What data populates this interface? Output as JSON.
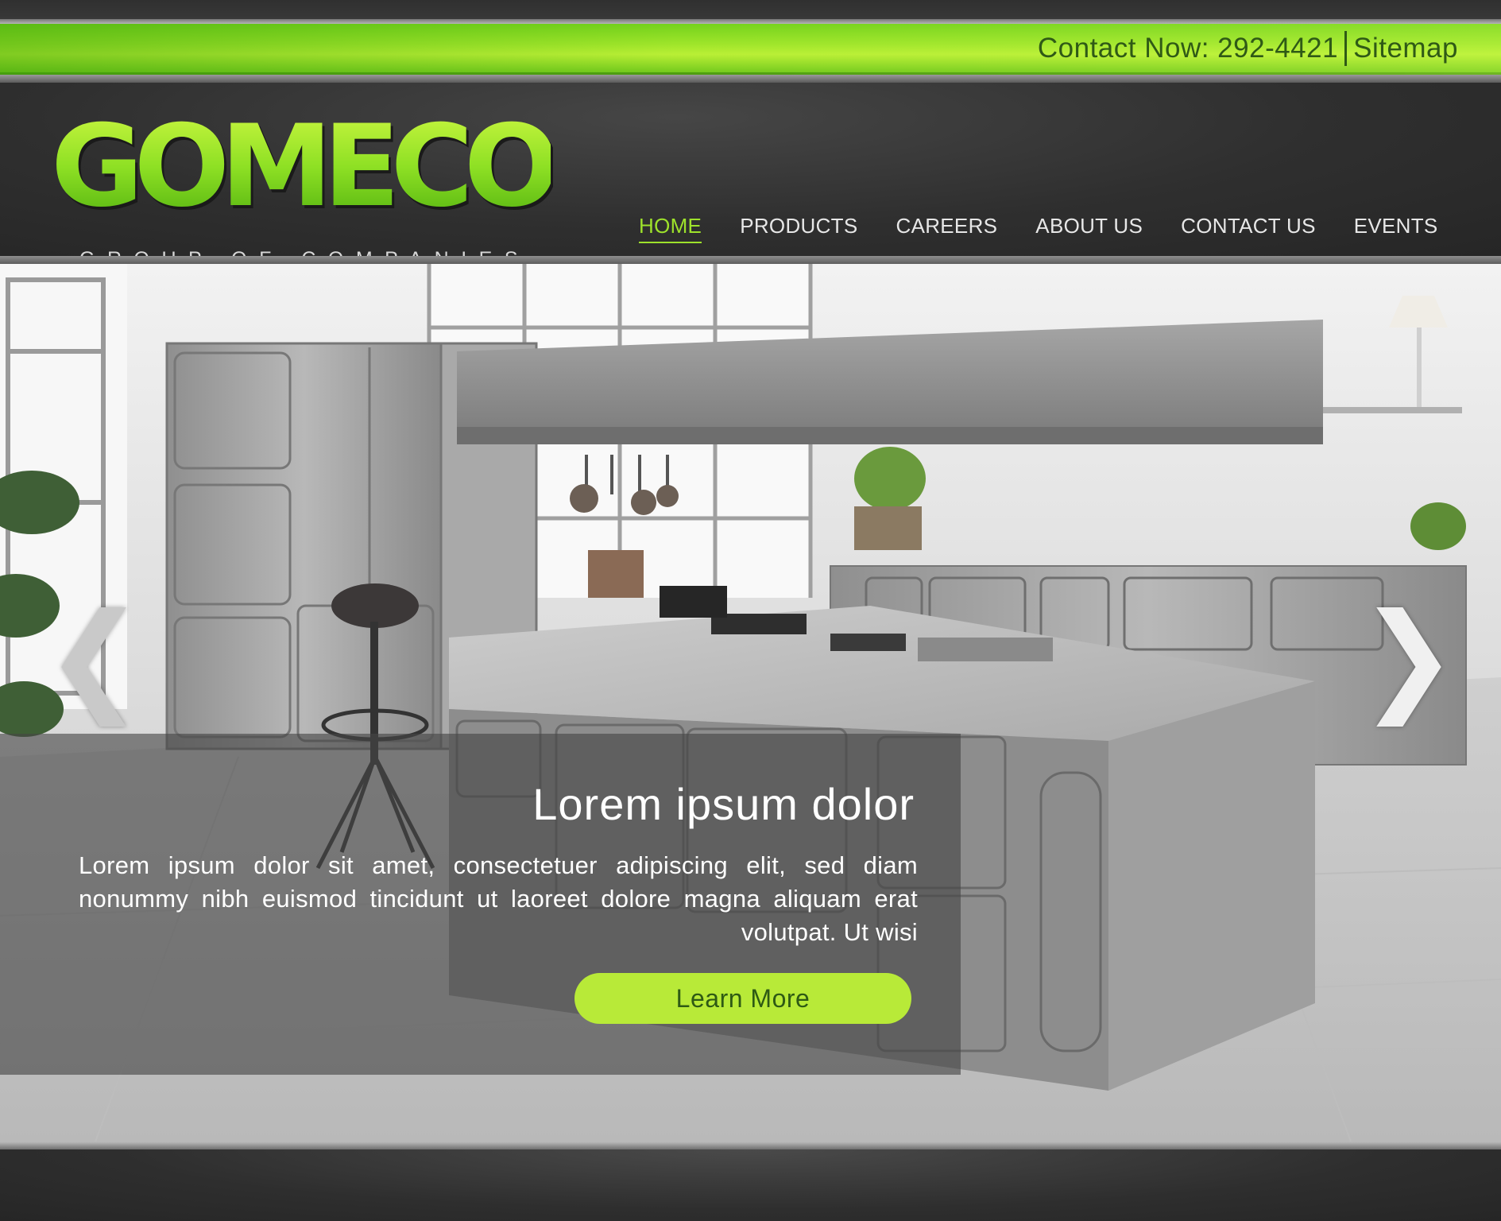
{
  "contact": {
    "text": "Contact Now: 292-4421",
    "sitemap_label": "Sitemap"
  },
  "logo": {
    "wordmark": "GOMECO",
    "tagline": "GROUP OF COMPANIES"
  },
  "nav": {
    "items": [
      {
        "label": "HOME",
        "active": true
      },
      {
        "label": "PRODUCTS",
        "active": false
      },
      {
        "label": "CAREERS",
        "active": false
      },
      {
        "label": "ABOUT US",
        "active": false
      },
      {
        "label": "CONTACT US",
        "active": false
      },
      {
        "label": "EVENTS",
        "active": false
      }
    ]
  },
  "hero": {
    "prev_arrow": "❮",
    "next_arrow": "❯",
    "title": "Lorem ipsum dolor",
    "body": "Lorem ipsum dolor sit amet, consectetuer adipiscing elit, sed diam nonummy nibh euismod tincidunt ut laoreet dolore magna aliquam erat volutpat. Ut wisi",
    "button_label": "Learn More"
  },
  "colors": {
    "accent_green": "#9ee22b",
    "button_green": "#b8ea38",
    "dark_bg": "#2b2b2b"
  }
}
